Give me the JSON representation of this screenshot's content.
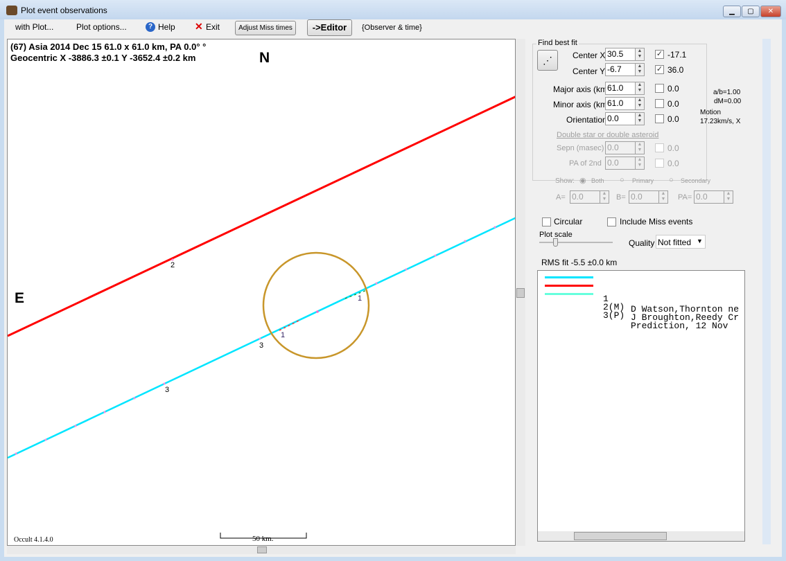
{
  "window": {
    "title": "Plot event observations"
  },
  "menu": {
    "with_plot": "with Plot...",
    "plot_options": "Plot options...",
    "help": "Help",
    "exit": "Exit",
    "adjust_miss": "Adjust Miss times",
    "editor": "->Editor",
    "observer_time": "{Observer & time}"
  },
  "plot": {
    "header1": "(67) Asia  2014 Dec 15   61.0 x 61.0 km, PA 0.0° °",
    "header2": "Geocentric  X  -3886.3 ±0.1  Y -3652.4 ±0.2 km",
    "north": "N",
    "east": "E",
    "version": "Occult 4.1.4.0",
    "scale": "50 km.",
    "chord_labels": [
      "2",
      "3",
      "3",
      "1",
      "1"
    ],
    "colors": {
      "observed": "#00e5ff",
      "miss": "#ff0000",
      "ellipse": "#c8962a"
    }
  },
  "fit": {
    "group": "Find best fit",
    "center_x_label": "Center X",
    "center_x": "30.5",
    "center_x_check": true,
    "center_x_result": "-17.1",
    "center_y_label": "Center Y",
    "center_y": "-6.7",
    "center_y_check": true,
    "center_y_result": "36.0",
    "major_label": "Major axis (km)",
    "major": "61.0",
    "major_result": "0.0",
    "minor_label": "Minor axis (km)",
    "minor": "61.0",
    "minor_result": "0.0",
    "orient_label": "Orientation",
    "orient": "0.0",
    "orient_result": "0.0",
    "ab": "a/b=1.00",
    "dm": "dM=0.00",
    "motion_label": "Motion",
    "motion": "17.23km/s, X",
    "double_label": "Double star  or  double asteroid",
    "sepn_label": "Sepn (masec)",
    "sepn": "0.0",
    "sepn_result": "0.0",
    "pa2_label": "PA of 2nd",
    "pa2": "0.0",
    "pa2_result": "0.0",
    "show_label": "Show:",
    "show_both": "Both",
    "show_primary": "Primary",
    "show_secondary": "Secondary",
    "a_label": "A=",
    "a": "0.0",
    "b_label": "B=",
    "b": "0.0",
    "pa_label": "PA=",
    "pa": "0.0",
    "circular": "Circular",
    "include_miss": "Include Miss events",
    "plot_scale": "Plot scale",
    "quality_label": "Quality",
    "quality": "Not fitted",
    "rms": "RMS fit -5.5 ±0.0 km"
  },
  "observers": [
    {
      "num": "1   ",
      "name": "D Watson,Thornton ne",
      "color": "#00e5ff"
    },
    {
      "num": "2(M)",
      "name": "J Broughton,Reedy Cr",
      "color": "#ff0000"
    },
    {
      "num": "3(P)",
      "name": "Prediction, 12 Nov",
      "color": "#66ffdd"
    }
  ]
}
